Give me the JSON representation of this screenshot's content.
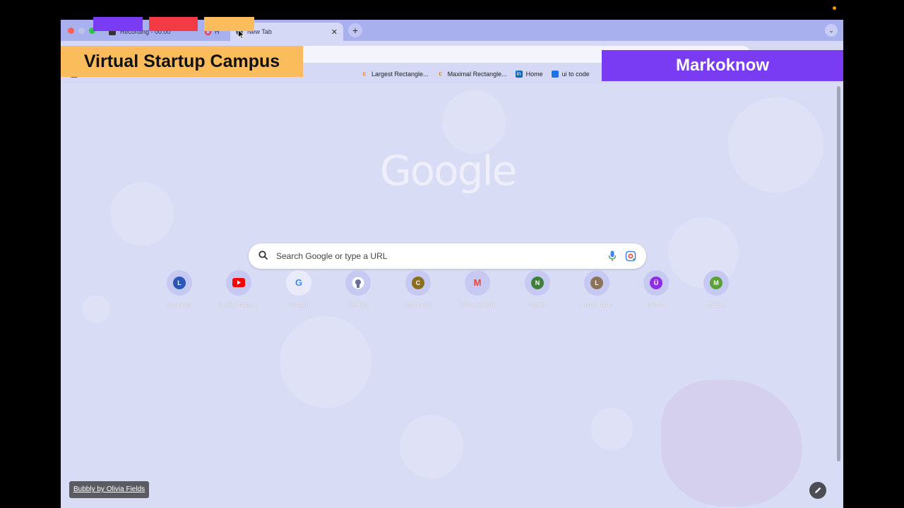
{
  "browser": {
    "tabs": [
      {
        "label": "Recording - 00:00"
      },
      {
        "label": "H"
      },
      {
        "label": "New Tab",
        "close_glyph": "✕"
      }
    ],
    "new_tab_glyph": "+",
    "tab_menu_glyph": "⌄"
  },
  "bookmarks": [
    {
      "label": "Largest Rectangle...",
      "icon": "leetcode-icon"
    },
    {
      "label": "Maximal Rectangle...",
      "icon": "leetcode-icon"
    },
    {
      "label": "Home",
      "icon": "linkedin-icon",
      "glyph": "in"
    },
    {
      "label": "ui to code",
      "icon": "bookmark-icon"
    }
  ],
  "ntp": {
    "logo": "Google",
    "search_placeholder": "Search Google or type a URL",
    "shortcuts": [
      {
        "initial": "L",
        "label": "localhost",
        "color": "#2c56b8"
      },
      {
        "initial": "",
        "label": "(180) Mahra...",
        "color": "#ff0000",
        "icon": "youtube-icon"
      },
      {
        "initial": "G",
        "label": "Google",
        "color": "#4285f4",
        "icon": "google-icon"
      },
      {
        "initial": "",
        "label": "GitHub",
        "color": "#24292e",
        "icon": "github-icon"
      },
      {
        "initial": "C",
        "label": "Document",
        "color": "#8a6d1f"
      },
      {
        "initial": "M",
        "label": "Inbox (3,540)",
        "color": "#ea4335",
        "icon": "gmail-icon"
      },
      {
        "initial": "N",
        "label": "Netlify",
        "color": "#3e7f3a"
      },
      {
        "initial": "L",
        "label": "home page",
        "color": "#8d7357"
      },
      {
        "initial": "Ü",
        "label": "udemy",
        "color": "#8e2ce6"
      },
      {
        "initial": "M",
        "label": "MEGA",
        "color": "#5aa13a"
      }
    ],
    "attribution": "Bubbly by Olivia Fields"
  },
  "overlays": {
    "left_banner": "Virtual Startup Campus",
    "right_banner": "Markoknow",
    "swatch_colors": [
      "#7a3cf3",
      "#f23b45",
      "#fbbd5c"
    ]
  }
}
